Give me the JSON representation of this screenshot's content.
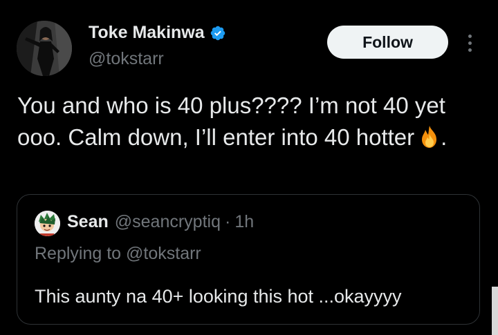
{
  "author": {
    "name": "Toke Makinwa",
    "handle": "@tokstarr",
    "verified": true,
    "avatar_icon": "profile-photo"
  },
  "actions": {
    "follow_label": "Follow",
    "more_icon": "more-vertical-icon"
  },
  "tweet": {
    "text": "You and who is 40 plus???? I’m not 40 yet ooo. Calm down, I’ll enter into 40 hotter",
    "emoji_icon": "fire-emoji",
    "trailing": "."
  },
  "quoted": {
    "name": "Sean",
    "handle": "@seancryptiq",
    "separator": "·",
    "time": "1h",
    "replying_to": "Replying to @tokstarr",
    "text": "This aunty na 40+ looking this hot ...okayyyy"
  },
  "colors": {
    "background": "#000000",
    "text": "#e7e9ea",
    "secondary": "#71767b",
    "verified": "#1d9bf0",
    "follow_bg": "#eff3f4",
    "border": "#2f3336"
  }
}
